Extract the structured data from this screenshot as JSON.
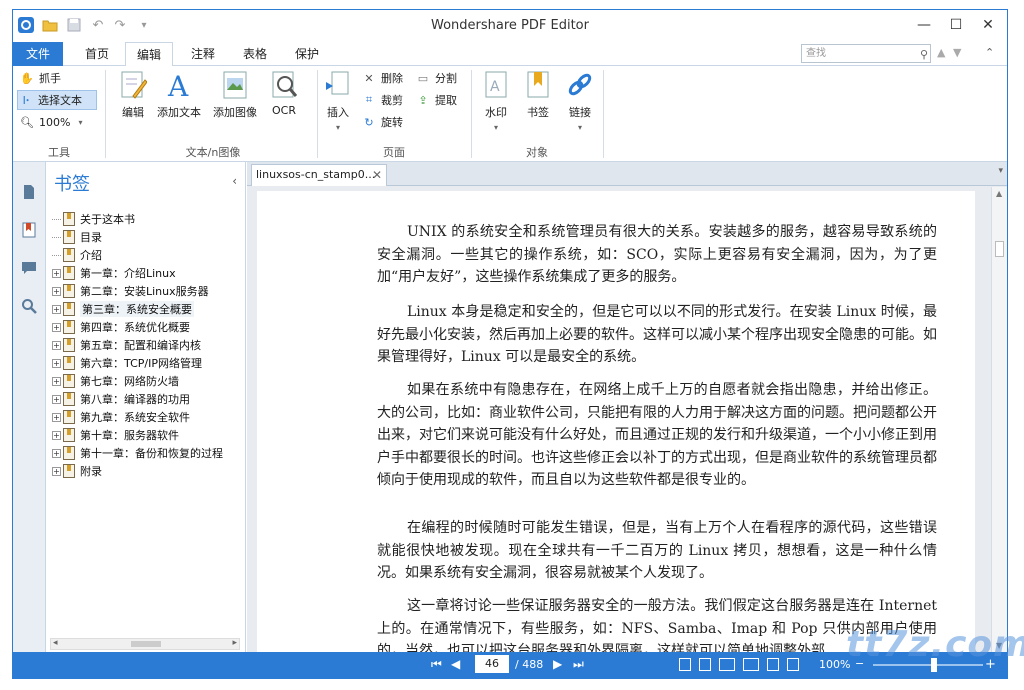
{
  "window": {
    "title": "Wondershare PDF Editor"
  },
  "menu": {
    "tabs": [
      "文件",
      "首页",
      "编辑",
      "注释",
      "表格",
      "保护"
    ],
    "active": "编辑",
    "search_placeholder": "查找"
  },
  "ribbon": {
    "tools_group": {
      "label": "工具",
      "hand": "抓手",
      "select_text": "选择文本",
      "zoom": "100%"
    },
    "text_image_group": {
      "label": "文本/n图像",
      "edit": "编辑",
      "add_text": "添加文本",
      "add_image": "添加图像",
      "ocr": "OCR"
    },
    "page_group": {
      "label": "页面",
      "insert": "插入",
      "delete": "删除",
      "crop": "裁剪",
      "rotate": "旋转",
      "split": "分割",
      "extract": "提取"
    },
    "object_group": {
      "label": "对象",
      "watermark": "水印",
      "bookmark": "书签",
      "link": "链接"
    }
  },
  "bookmarks": {
    "title": "书签",
    "items": [
      {
        "label": "关于这本书",
        "expandable": false
      },
      {
        "label": "目录",
        "expandable": false
      },
      {
        "label": "介绍",
        "expandable": false
      },
      {
        "label": "第一章：介绍Linux",
        "expandable": true
      },
      {
        "label": "第二章：安装Linux服务器",
        "expandable": true
      },
      {
        "label": "第三章：系统安全概要",
        "expandable": true
      },
      {
        "label": "第四章：系统优化概要",
        "expandable": true
      },
      {
        "label": "第五章：配置和编译内核",
        "expandable": true
      },
      {
        "label": "第六章：TCP/IP网络管理",
        "expandable": true
      },
      {
        "label": "第七章：网络防火墙",
        "expandable": true
      },
      {
        "label": "第八章：编译器的功用",
        "expandable": true
      },
      {
        "label": "第九章：系统安全软件",
        "expandable": true
      },
      {
        "label": "第十章：服务器软件",
        "expandable": true
      },
      {
        "label": "第十一章：备份和恢复的过程",
        "expandable": true
      },
      {
        "label": "附录",
        "expandable": true
      }
    ],
    "highlighted_index": 5
  },
  "document": {
    "tab_name": "linuxsos-cn_stamp0...",
    "paragraphs": [
      "UNIX 的系统安全和系统管理员有很大的关系。安装越多的服务，越容易导致系统的安全漏洞。一些其它的操作系统，如：SCO，实际上更容易有安全漏洞，因为，为了更加“用户友好”，这些操作系统集成了更多的服务。",
      "Linux 本身是稳定和安全的，但是它可以以不同的形式发行。在安装 Linux 时候，最好先最小化安装，然后再加上必要的软件。这样可以减小某个程序出现安全隐患的可能。如果管理得好，Linux 可以是最安全的系统。",
      "如果在系统中有隐患存在，在网络上成千上万的自愿者就会指出隐患，并给出修正。大的公司，比如：商业软件公司，只能把有限的人力用于解决这方面的问题。把问题都公开出来，对它们来说可能没有什么好处，而且通过正规的发行和升级渠道，一个小小修正到用户手中都要很长的时间。也许这些修正会以补丁的方式出现，但是商业软件的系统管理员都倾向于使用现成的软件，而且自以为这些软件都是很专业的。",
      "在编程的时候随时可能发生错误，但是，当有上万个人在看程序的源代码，这些错误就能很快地被发现。现在全球共有一千二百万的 Linux 拷贝，想想看，这是一种什么情况。如果系统有安全漏洞，很容易就被某个人发现了。",
      "这一章将讨论一些保证服务器安全的一般方法。我们假定这台服务器是连在 Internet 上的。在通常情况下，有些服务，如：NFS、Samba、Imap 和 Pop 只供内部用户使用的，当然，也可以把这台服务器和外界隔离，这样就可以简单地调整外部"
    ]
  },
  "statusbar": {
    "current_page": "46",
    "total_pages": "/ 488",
    "zoom": "100%"
  },
  "watermark_text": "tt7z.com",
  "colors": {
    "accent": "#2b7bd4"
  }
}
